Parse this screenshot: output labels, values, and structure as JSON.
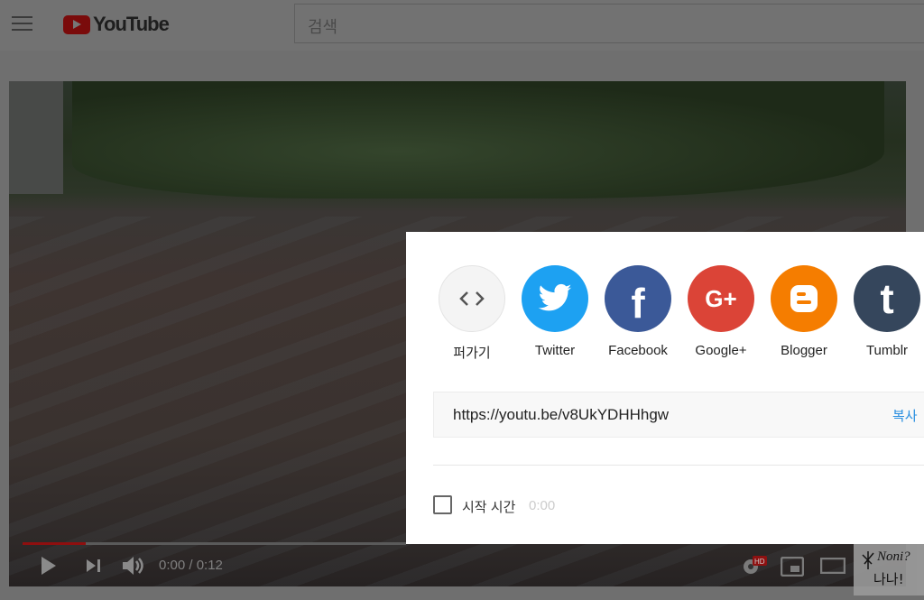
{
  "header": {
    "logo_text": "YouTube",
    "search_placeholder": "검색"
  },
  "player": {
    "time": "0:00 / 0:12",
    "progress_percent": 16.5,
    "hd_badge": "HD"
  },
  "share_dialog": {
    "targets": [
      {
        "label": "퍼가기",
        "icon": "embed-icon",
        "color": "#f4f4f4"
      },
      {
        "label": "Twitter",
        "icon": "twitter-icon",
        "color": "#1da1f2"
      },
      {
        "label": "Facebook",
        "icon": "facebook-icon",
        "color": "#3b5998"
      },
      {
        "label": "Google+",
        "icon": "google-plus-icon",
        "color": "#db4437"
      },
      {
        "label": "Blogger",
        "icon": "blogger-icon",
        "color": "#f57d00"
      },
      {
        "label": "Tumblr",
        "icon": "tumblr-icon",
        "color": "#35465c"
      }
    ],
    "url": "https://youtu.be/v8UkYDHHhgw",
    "copy_label": "복사",
    "start_time_label": "시작 시간",
    "start_time_value": "0:00"
  },
  "watermark": {
    "text": "Noni? 나나!"
  }
}
